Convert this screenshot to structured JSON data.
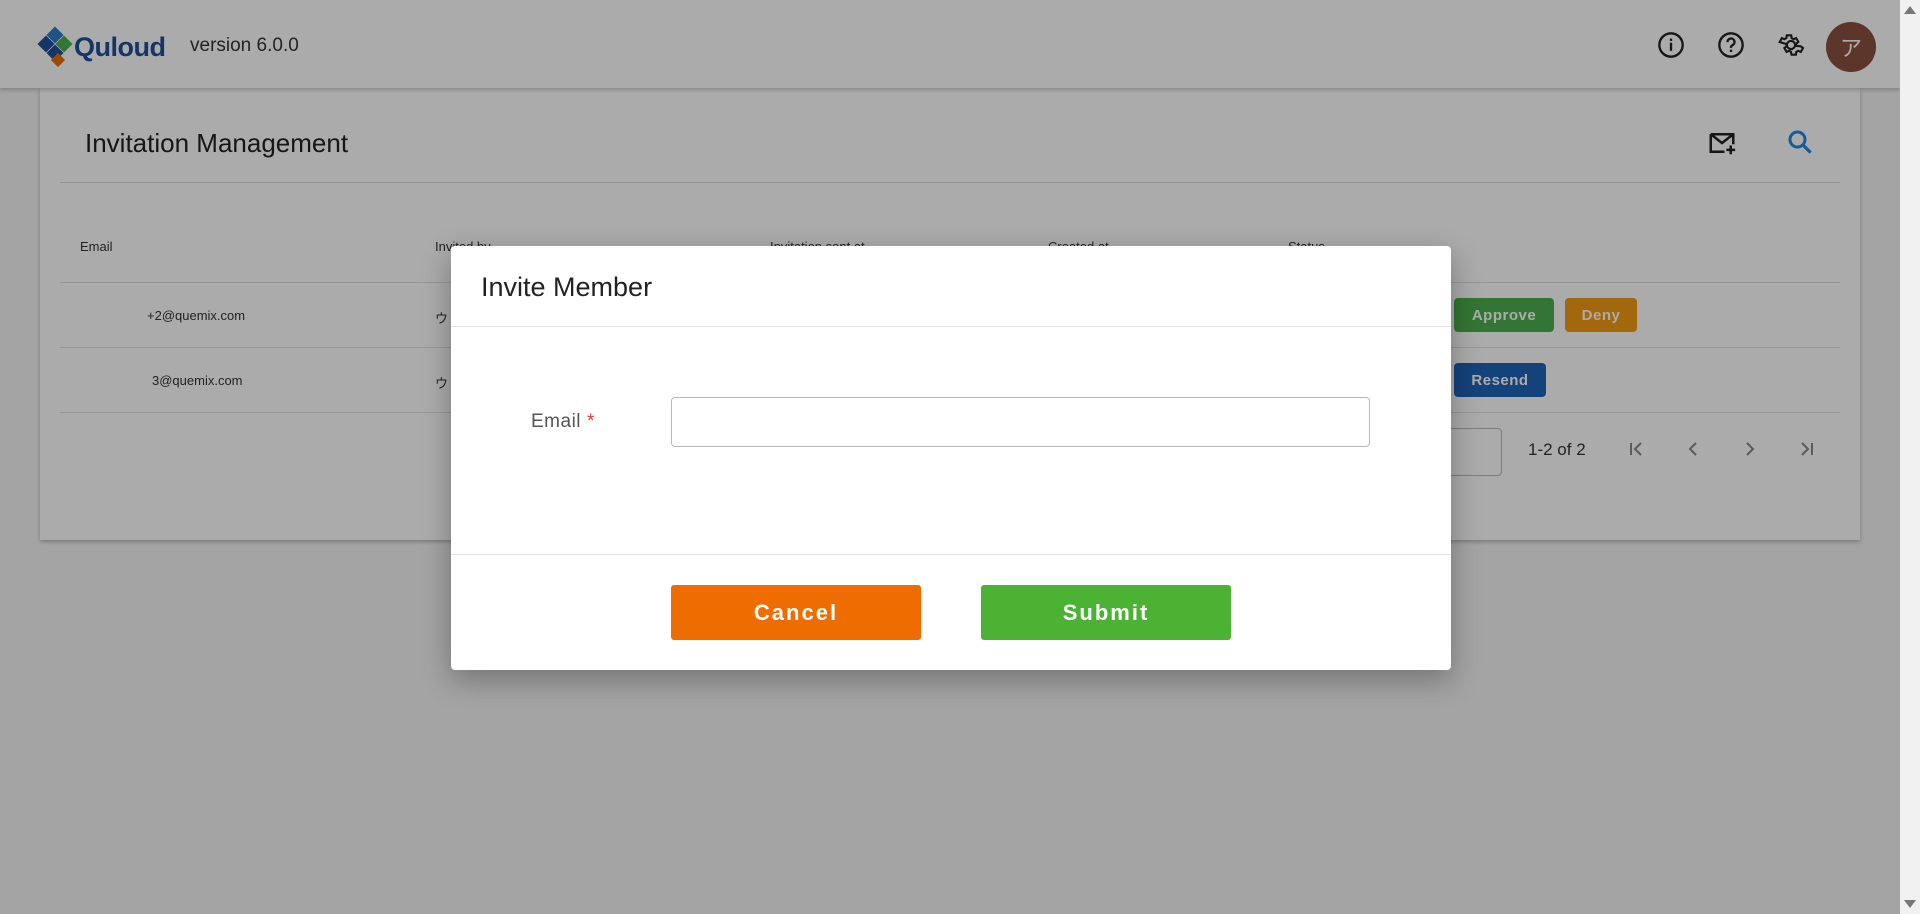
{
  "header": {
    "logo_text": "Quloud",
    "version": "version 6.0.0",
    "avatar_initial": "ア"
  },
  "page": {
    "title": "Invitation Management"
  },
  "table": {
    "columns": [
      "Email",
      "Invited by",
      "Invitation sent at",
      "Created at",
      "Status"
    ],
    "rows": [
      {
        "email": "+2@quemix.com",
        "invited_by": "ウ"
      },
      {
        "email": "3@quemix.com",
        "invited_by": "ウ"
      }
    ],
    "actions": {
      "approve": "Approve",
      "deny": "Deny",
      "resend": "Resend"
    }
  },
  "pagination": {
    "range": "1-2 of 2"
  },
  "dialog": {
    "title": "Invite Member",
    "email_label": "Email",
    "required_mark": "*",
    "email_value": "",
    "cancel_label": "Cancel",
    "submit_label": "Submit"
  },
  "colors": {
    "brand_blue": "#1f4f9c",
    "approve_green": "#4caf50",
    "deny_orange": "#f39c12",
    "resend_blue": "#1e63b8",
    "cancel_orange": "#ef6c00",
    "submit_green": "#4cb233",
    "search_blue": "#1e88e5",
    "avatar_brown": "#8a4f40"
  }
}
